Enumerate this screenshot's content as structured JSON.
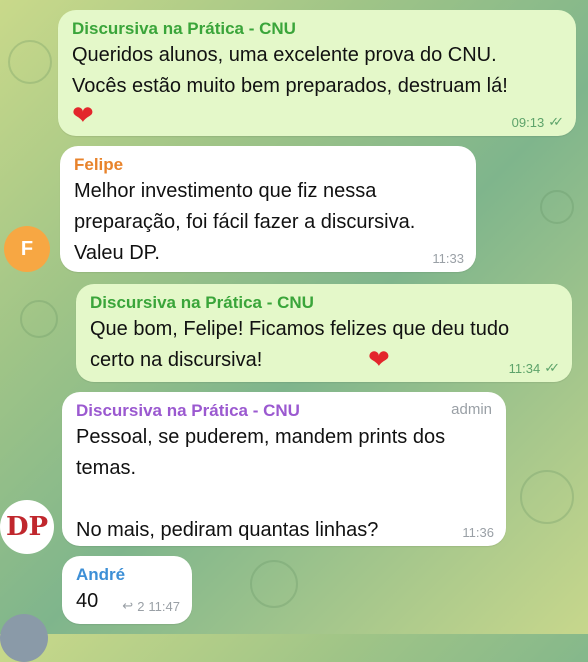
{
  "messages": [
    {
      "sender": "Discursiva na Prática - CNU",
      "text": "Queridos alunos, uma excelente prova do CNU.\nVocês estão muito bem preparados, destruam lá!",
      "emoji": "❤",
      "time": "09:13"
    },
    {
      "sender": "Felipe",
      "text": "Melhor investimento que fiz nessa\npreparação, foi fácil fazer a discursiva.\nValeu DP.",
      "time": "11:33",
      "avatar_initial": "F"
    },
    {
      "sender": "Discursiva na Prática - CNU",
      "text": "Que bom, Felipe! Ficamos felizes que deu tudo\ncerto na discursiva!",
      "emoji": "❤",
      "time": "11:34"
    },
    {
      "sender": "Discursiva na Prática - CNU",
      "role": "admin",
      "text": "Pessoal, se puderem, mandem prints dos\ntemas.\n\nNo mais, pediram quantas linhas?",
      "time": "11:36",
      "avatar_text": "DP"
    },
    {
      "sender": "André",
      "text": "40",
      "reply_count": "2",
      "time": "11:47"
    }
  ],
  "colors": {
    "outgoing_bubble": "#e4f8c9",
    "incoming_bubble": "#ffffff",
    "channel_name": "#3aa53a",
    "felipe_name": "#e8832b",
    "admin_name": "#9b59d0",
    "andre_name": "#3d8fd6",
    "felipe_avatar": "#f7a743",
    "dp_avatar": "#c0272d"
  }
}
